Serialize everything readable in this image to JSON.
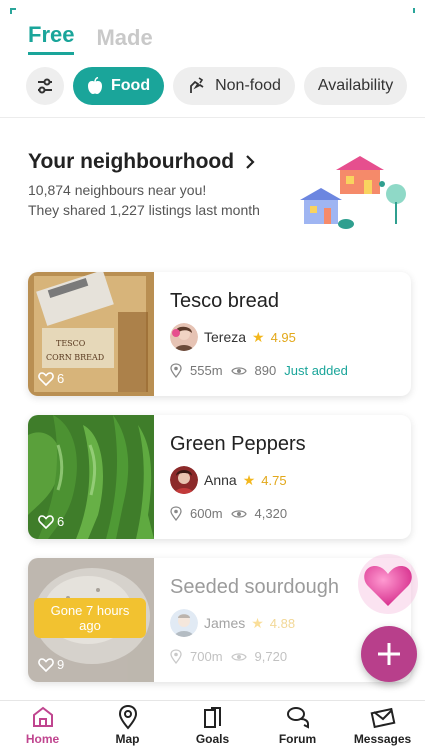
{
  "top_tabs": [
    {
      "label": "Free",
      "active": true
    },
    {
      "label": "Made",
      "active": false
    }
  ],
  "filters": [
    {
      "label": "",
      "icon": "sliders-icon"
    },
    {
      "label": "Food",
      "icon": "apple-icon",
      "active": true
    },
    {
      "label": "Non-food",
      "icon": "hand-icon"
    },
    {
      "label": "Availability",
      "icon": ""
    }
  ],
  "neighbourhood": {
    "title": "Your neighbourhood",
    "line1": "10,874 neighbours near you!",
    "line2": "They shared 1,227 listings last month"
  },
  "listings": [
    {
      "title": "Tesco bread",
      "user": "Tereza",
      "rating": "4.95",
      "distance": "555m",
      "views": "890",
      "tag": "Just added",
      "likes": "6"
    },
    {
      "title": "Green Peppers",
      "user": "Anna",
      "rating": "4.75",
      "distance": "600m",
      "views": "4,320",
      "tag": "",
      "likes": "6"
    },
    {
      "title": "Seeded sourdough",
      "user": "James",
      "rating": "4.88",
      "distance": "700m",
      "views": "9,720",
      "tag": "",
      "likes": "9",
      "badge": "Gone 7 hours ago"
    }
  ],
  "nav": [
    {
      "label": "Home",
      "icon": "home-icon",
      "active": true
    },
    {
      "label": "Map",
      "icon": "map-pin-icon"
    },
    {
      "label": "Goals",
      "icon": "goals-icon"
    },
    {
      "label": "Forum",
      "icon": "forum-icon"
    },
    {
      "label": "Messages",
      "icon": "messages-icon"
    }
  ],
  "colors": {
    "accent": "#1aa59a",
    "brand": "#b83f8b",
    "star": "#f3b71d",
    "badge": "#f2c230"
  }
}
